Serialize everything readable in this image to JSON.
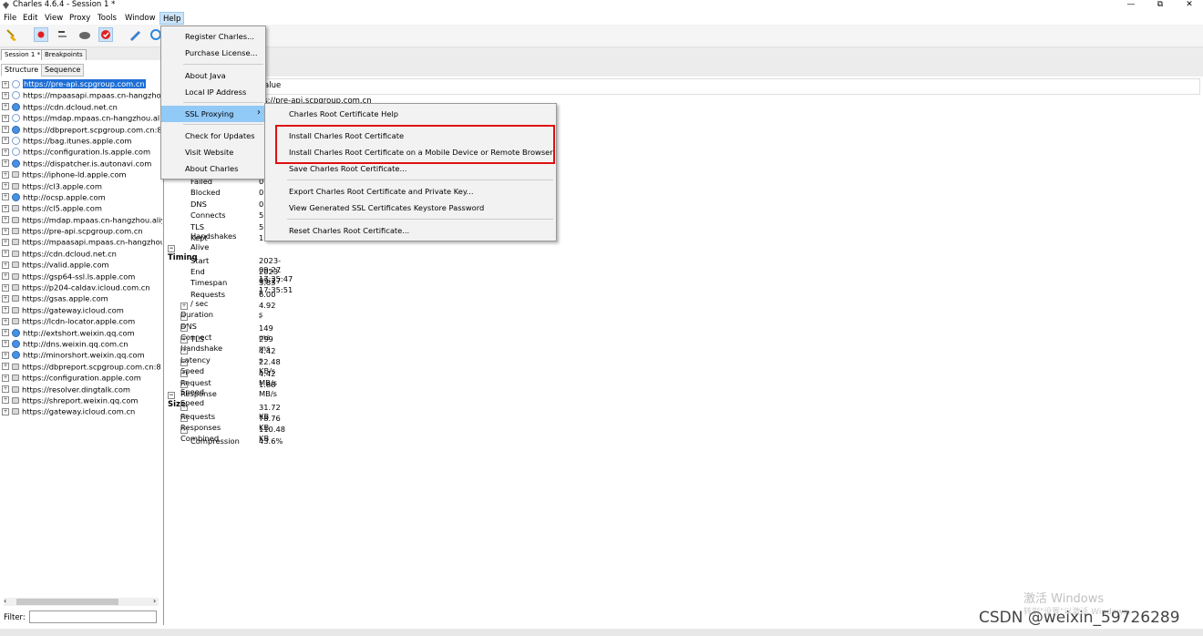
{
  "window": {
    "title": "Charles 4.6.4 - Session 1 *",
    "minimize": "—",
    "restore": "⧉",
    "close": "✕"
  },
  "menubar": [
    "File",
    "Edit",
    "View",
    "Proxy",
    "Tools",
    "Window",
    "Help"
  ],
  "session_tabs": [
    "Session 1 *",
    "Breakpoints"
  ],
  "left_tabs": [
    "Structure",
    "Sequence"
  ],
  "tree": [
    {
      "icon": "bolt",
      "label": "https://pre-api.scpgroup.com.cn",
      "selected": true
    },
    {
      "icon": "bolt",
      "label": "https://mpaasapi.mpaas.cn-hangzhou"
    },
    {
      "icon": "globe",
      "label": "https://cdn.dcloud.net.cn"
    },
    {
      "icon": "bolt",
      "label": "https://mdap.mpaas.cn-hangzhou.ali"
    },
    {
      "icon": "globe",
      "label": "https://dbpreport.scpgroup.com.cn:8"
    },
    {
      "icon": "bolt",
      "label": "https://bag.itunes.apple.com"
    },
    {
      "icon": "bolt",
      "label": "https://configuration.ls.apple.com"
    },
    {
      "icon": "globe",
      "label": "https://dispatcher.is.autonavi.com"
    },
    {
      "icon": "lock",
      "label": "https://iphone-ld.apple.com"
    },
    {
      "icon": "lock",
      "label": "https://cl3.apple.com"
    },
    {
      "icon": "globe",
      "label": "http://ocsp.apple.com"
    },
    {
      "icon": "lock",
      "label": "https://cl5.apple.com"
    },
    {
      "icon": "lock",
      "label": "https://mdap.mpaas.cn-hangzhou.aliy"
    },
    {
      "icon": "lock",
      "label": "https://pre-api.scpgroup.com.cn"
    },
    {
      "icon": "lock",
      "label": "https://mpaasapi.mpaas.cn-hangzhou"
    },
    {
      "icon": "lock",
      "label": "https://cdn.dcloud.net.cn"
    },
    {
      "icon": "lock",
      "label": "https://valid.apple.com"
    },
    {
      "icon": "lock",
      "label": "https://gsp64-ssl.ls.apple.com"
    },
    {
      "icon": "lock",
      "label": "https://p204-caldav.icloud.com.cn"
    },
    {
      "icon": "lock",
      "label": "https://gsas.apple.com"
    },
    {
      "icon": "lock",
      "label": "https://gateway.icloud.com"
    },
    {
      "icon": "lock",
      "label": "https://lcdn-locator.apple.com"
    },
    {
      "icon": "globe",
      "label": "http://extshort.weixin.qq.com"
    },
    {
      "icon": "globe",
      "label": "http://dns.weixin.qq.com.cn"
    },
    {
      "icon": "globe",
      "label": "http://minorshort.weixin.qq.com"
    },
    {
      "icon": "lock",
      "label": "https://dbpreport.scpgroup.com.cn:8"
    },
    {
      "icon": "lock",
      "label": "https://configuration.apple.com"
    },
    {
      "icon": "lock",
      "label": "https://resolver.dingtalk.com"
    },
    {
      "icon": "lock",
      "label": "https://shreport.weixin.qq.com"
    },
    {
      "icon": "lock",
      "label": "https://gateway.icloud.com.cn"
    }
  ],
  "filter_label": "Filter:",
  "right": {
    "tab_fragment": "t",
    "header_value": "alue",
    "url_fragment": "os://pre-api.scpgroup.com.cn",
    "stats_partial": [
      {
        "k": "Failed",
        "v": "0"
      },
      {
        "k": "Blocked",
        "v": "0"
      },
      {
        "k": "DNS",
        "v": "0"
      },
      {
        "k": "Connects",
        "v": "5"
      },
      {
        "k": "TLS Handshakes",
        "v": "5"
      },
      {
        "k": "Kept Alive",
        "v": "1"
      }
    ],
    "timing_title": "Timing",
    "timing": [
      {
        "k": "Start",
        "v": "2023-09-27 17:35:47",
        "exp": false
      },
      {
        "k": "End",
        "v": "2023-09-27 17:35:51",
        "exp": false
      },
      {
        "k": "Timespan",
        "v": "3.83 s",
        "exp": false
      },
      {
        "k": "Requests / sec",
        "v": "6.00",
        "exp": false
      },
      {
        "k": "Duration",
        "v": "4.92 s",
        "exp": true
      },
      {
        "k": "DNS",
        "v": "-",
        "exp": true
      },
      {
        "k": "Connect",
        "v": "149 ms",
        "exp": true
      },
      {
        "k": "TLS Handshake",
        "v": "299 ms",
        "exp": true
      },
      {
        "k": "Latency",
        "v": "4.42 s",
        "exp": true
      },
      {
        "k": "Speed",
        "v": "22.48 KB/s",
        "exp": true
      },
      {
        "k": "Request Speed",
        "v": "4.42 MB/s",
        "exp": true
      },
      {
        "k": "Response Speed",
        "v": "1.88 MB/s",
        "exp": true
      }
    ],
    "size_title": "Size",
    "size": [
      {
        "k": "Requests",
        "v": "31.72 KB",
        "exp": true
      },
      {
        "k": "Responses",
        "v": "78.76 KB",
        "exp": true
      },
      {
        "k": "Combined",
        "v": "110.48 KB",
        "exp": true
      },
      {
        "k": "Compression",
        "v": "43.6%",
        "exp": false
      }
    ]
  },
  "help_menu": [
    "Register Charles...",
    "Purchase License...",
    "About Java",
    "Local IP Address",
    "SSL Proxying",
    "Check for Updates",
    "Visit Website",
    "About Charles"
  ],
  "ssl_submenu": [
    "Charles Root Certificate Help",
    "Install Charles Root Certificate",
    "Install Charles Root Certificate on a Mobile Device or Remote Browser",
    "Save Charles Root Certificate...",
    "Export Charles Root Certificate and Private Key...",
    "View Generated SSL Certificates Keystore Password",
    "Reset Charles Root Certificate..."
  ],
  "submenu_arrow": "›",
  "watermark": {
    "line1": "激活 Windows",
    "line2": "转到\"设置\"以激活 Windows。"
  },
  "csdn": "CSDN @weixin_59726289"
}
